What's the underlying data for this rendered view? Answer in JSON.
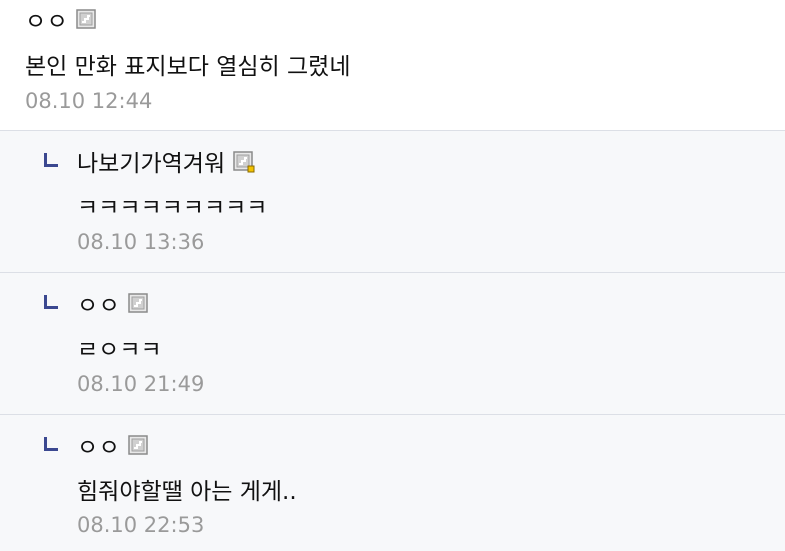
{
  "comments": [
    {
      "nickname": "ㅇㅇ",
      "text": "본인 만화 표지보다 열심히 그렸네",
      "date": "08.10 12:44"
    }
  ],
  "replies": [
    {
      "nickname": "나보기가역겨워",
      "text": "ㅋㅋㅋㅋㅋㅋㅋㅋㅋ",
      "date": "08.10 13:36"
    },
    {
      "nickname": "ㅇㅇ",
      "text": "ㄹㅇㅋㅋ",
      "date": "08.10 21:49"
    },
    {
      "nickname": "ㅇㅇ",
      "text": "힘줘야할땔 아는 게게..",
      "date": "08.10 22:53"
    }
  ],
  "icons": {
    "gallog": "gallog-icon",
    "gallog_fixed": "gallog-fixed-icon",
    "reply": "reply-arrow-icon"
  },
  "colors": {
    "reply_mark": "#3b4890",
    "date": "#9a9a9a",
    "reply_bg": "#f7f8fa",
    "divider": "#dcdfe6"
  }
}
